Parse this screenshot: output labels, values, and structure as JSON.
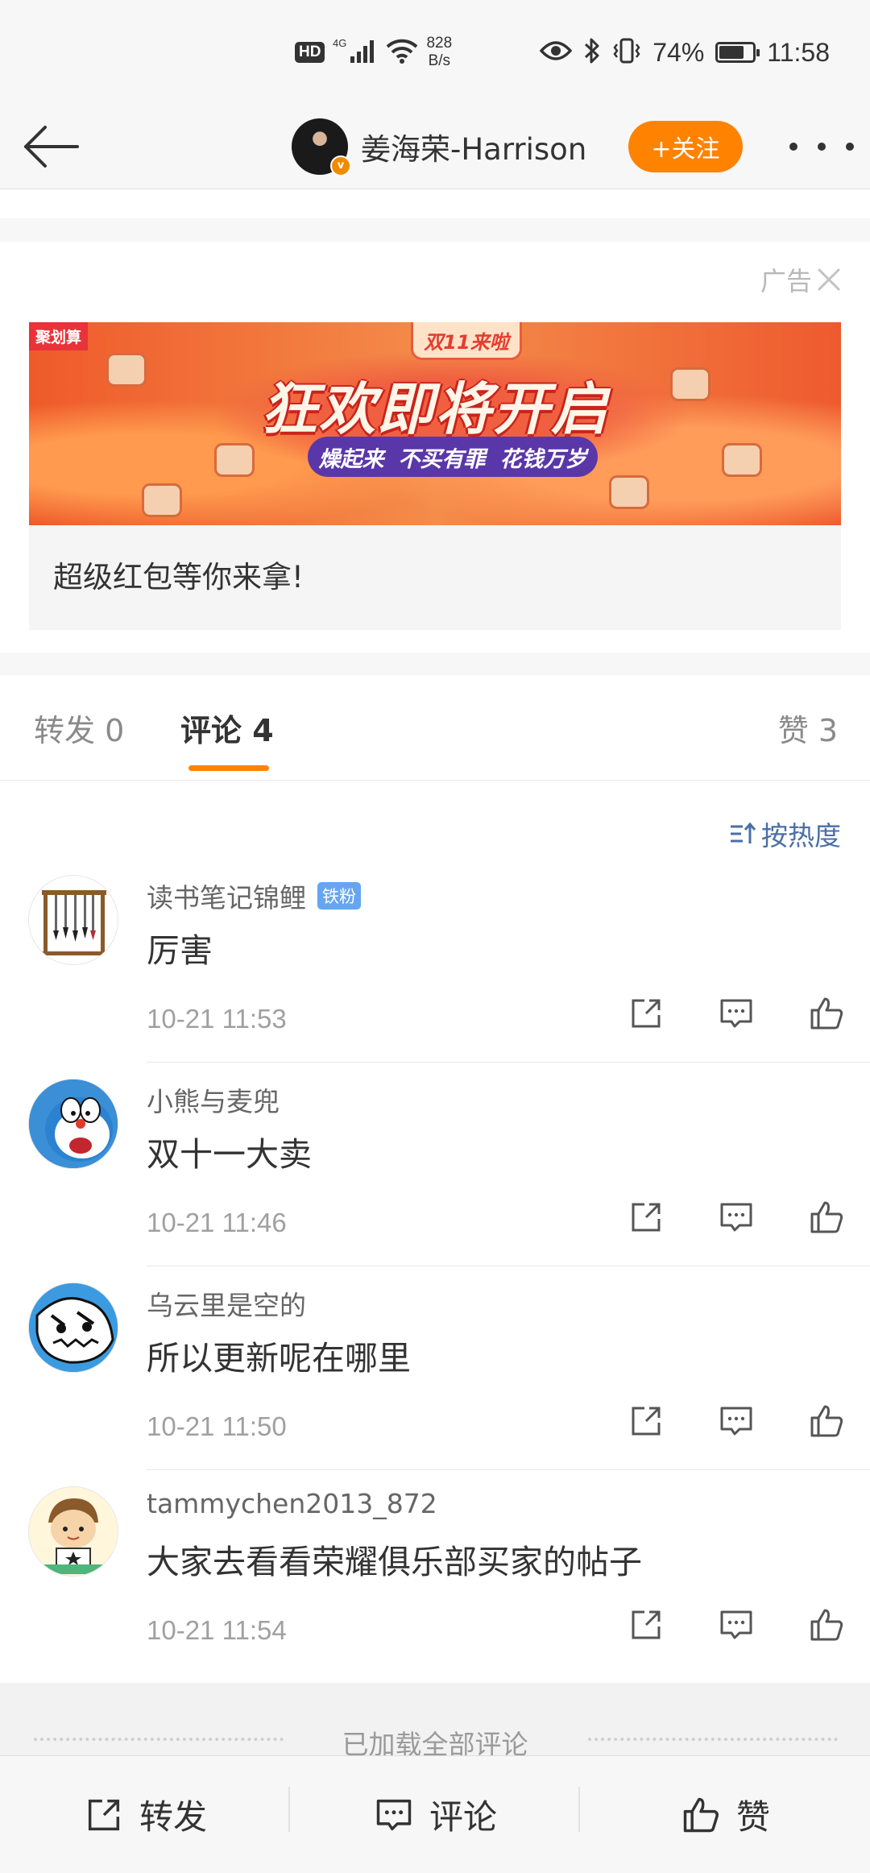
{
  "status_bar": {
    "hd": "HD",
    "network": "4G",
    "speed_value": "828",
    "speed_unit": "B/s",
    "battery_percent": "74%",
    "battery_level": 0.74,
    "time": "11:58"
  },
  "nav": {
    "user_name": "姜海荣-Harrison",
    "follow_label": "+关注"
  },
  "ad": {
    "label": "广告",
    "tag": "聚划算",
    "top_badge": "双11来啦",
    "headline": "狂欢即将开启",
    "slogan": [
      "燥起来",
      "不买有罪",
      "花钱万岁"
    ],
    "caption": "超级红包等你来拿!"
  },
  "tabs": {
    "repost": "转发 0",
    "comment": "评论 4",
    "like": "赞 3"
  },
  "sort_label": "按热度",
  "comments": [
    {
      "user": "读书笔记锦鲤",
      "badge": "铁粉",
      "text": "厉害",
      "time": "10-21 11:53"
    },
    {
      "user": "小熊与麦兜",
      "badge": "",
      "text": "双十一大卖",
      "time": "10-21 11:46"
    },
    {
      "user": "乌云里是空的",
      "badge": "",
      "text": "所以更新呢在哪里",
      "time": "10-21 11:50"
    },
    {
      "user": "tammychen2013_872",
      "badge": "",
      "text": "大家去看看荣耀俱乐部买家的帖子",
      "time": "10-21 11:54"
    }
  ],
  "loaded_all": "已加载全部评论",
  "bottom_bar": {
    "repost": "转发",
    "comment": "评论",
    "like": "赞"
  },
  "colors": {
    "accent": "#ff8200",
    "link": "#4a6fa5",
    "fan_badge": "#66a6f0"
  }
}
